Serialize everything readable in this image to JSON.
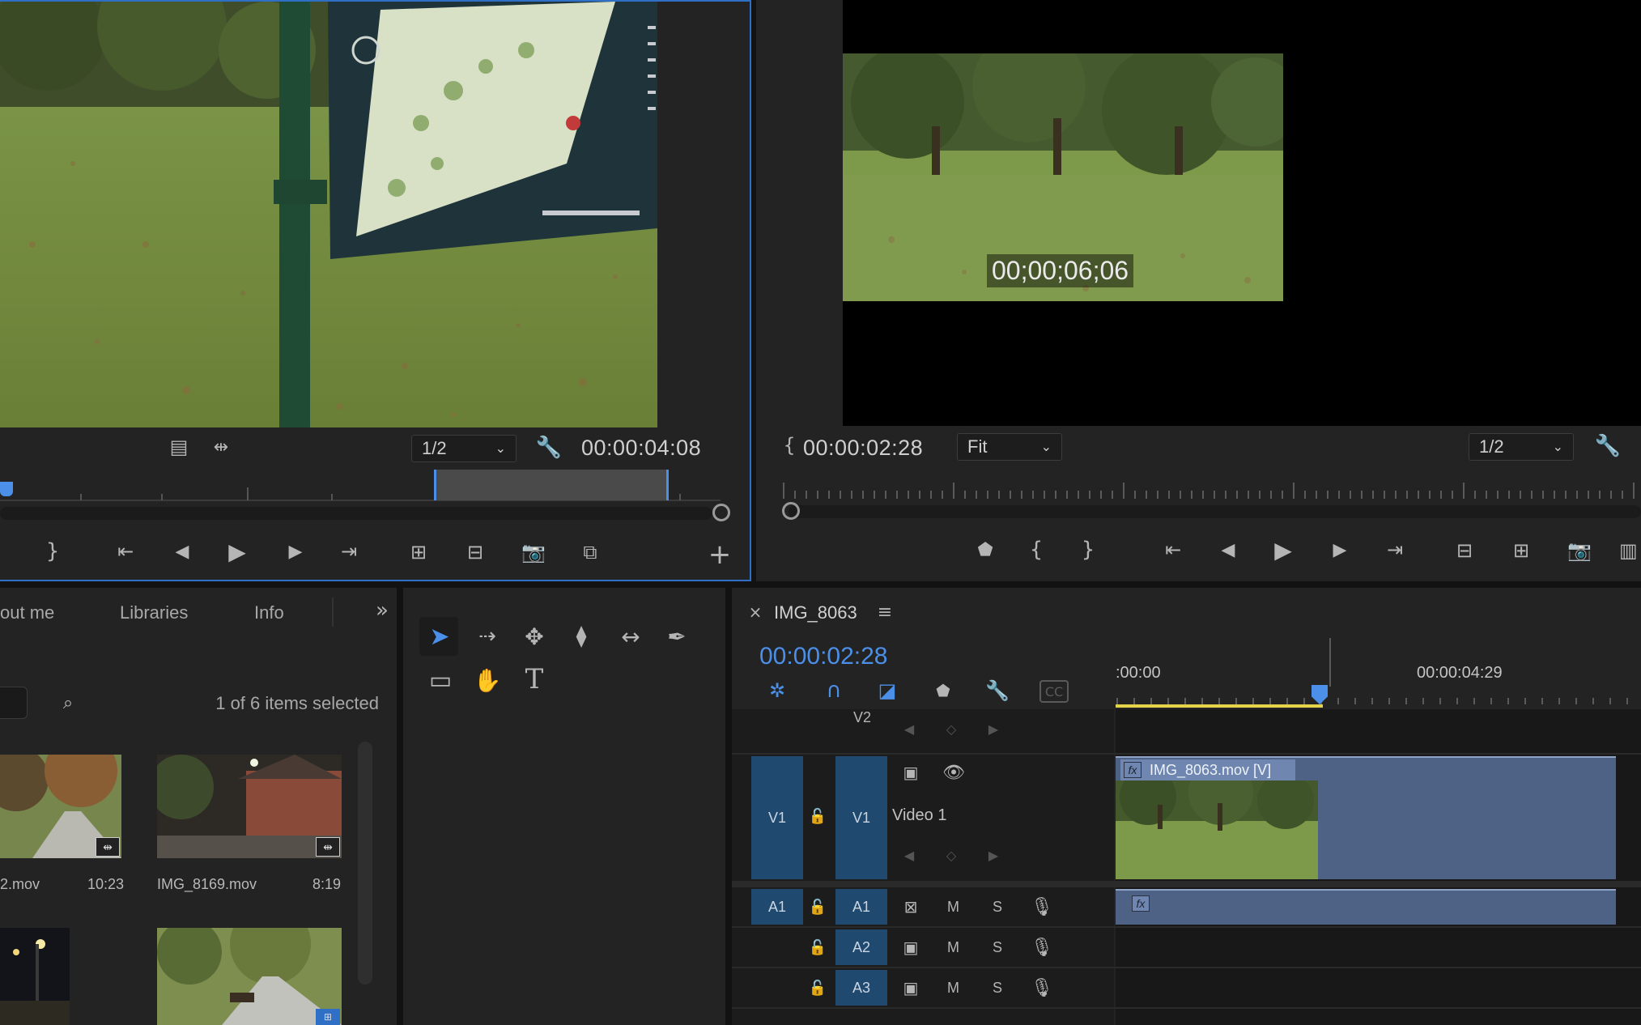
{
  "source_monitor": {
    "zoom": "1/2",
    "timecode": "00:00:04:08"
  },
  "program_monitor": {
    "in_timecode": "00:00:02:28",
    "fit": "Fit",
    "zoom": "1/2",
    "overlay_timecode": "00;00;06;06"
  },
  "project_panel": {
    "tabs": [
      "out me",
      "Libraries",
      "Info"
    ],
    "selection_status": "1 of 6 items selected",
    "clips": [
      {
        "name": "2.mov",
        "duration": "10:23"
      },
      {
        "name": "IMG_8169.mov",
        "duration": "8:19"
      }
    ]
  },
  "timeline": {
    "sequence_name": "IMG_8063",
    "timecode": "00:00:02:28",
    "ruler": [
      ":00:00",
      "00:00:04:29"
    ],
    "tracks": {
      "v2": "V2",
      "v1_source": "V1",
      "v1": "V1",
      "v1_name": "Video 1",
      "a1_source": "A1",
      "a1": "A1",
      "a2": "A2",
      "a3": "A3",
      "mute": "M",
      "solo": "S"
    },
    "clip_video_name": "IMG_8063.mov [V]",
    "fx_label": "fx"
  },
  "colors": {
    "accent_blue": "#4c8fe8",
    "track_blue": "#20496f",
    "clip_blue": "#4e6285",
    "work_area": "#e2d44a"
  }
}
